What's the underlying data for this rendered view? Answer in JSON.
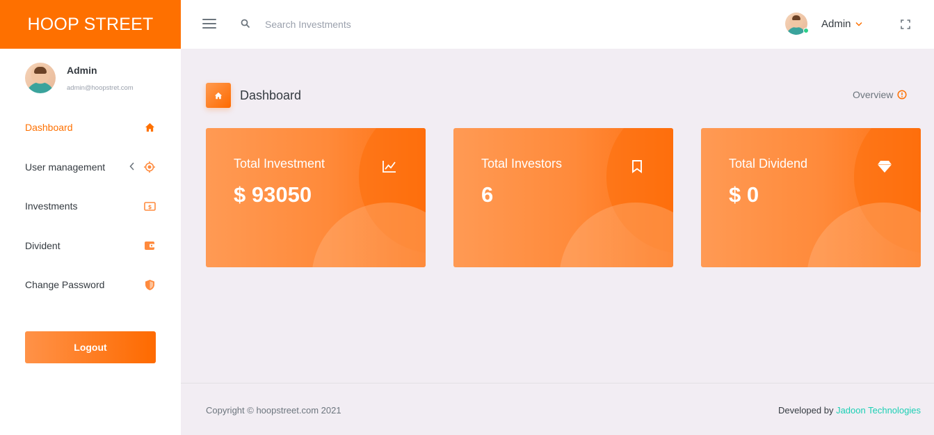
{
  "brand": {
    "name": "HOOP STREET"
  },
  "profile": {
    "name": "Admin",
    "email": "admin@hoopstret.com"
  },
  "sidebar": {
    "items": [
      {
        "label": "Dashboard",
        "icon": "home-icon",
        "active": true
      },
      {
        "label": "User management",
        "icon": "crosshair-icon",
        "has_submenu": true
      },
      {
        "label": "Investments",
        "icon": "dollar-bill-icon"
      },
      {
        "label": "Divident",
        "icon": "wallet-icon"
      },
      {
        "label": "Change Password",
        "icon": "shield-icon"
      }
    ],
    "logout_label": "Logout"
  },
  "topbar": {
    "search_placeholder": "Search Investments",
    "user_name": "Admin"
  },
  "page": {
    "title": "Dashboard",
    "overview_label": "Overview"
  },
  "cards": [
    {
      "title": "Total Investment",
      "value": "$ 93050",
      "icon": "chart-line-icon"
    },
    {
      "title": "Total Investors",
      "value": "6",
      "icon": "bookmark-icon"
    },
    {
      "title": "Total Dividend",
      "value": "$ 0",
      "icon": "diamond-icon"
    }
  ],
  "footer": {
    "copyright": "Copyright © hoopstreet.com 2021",
    "developed_by_prefix": "Developed by",
    "developer_name": "Jadoon Technologies"
  },
  "colors": {
    "accent": "#fe7000",
    "background": "#f2edf3",
    "link": "#1bcfb4"
  }
}
